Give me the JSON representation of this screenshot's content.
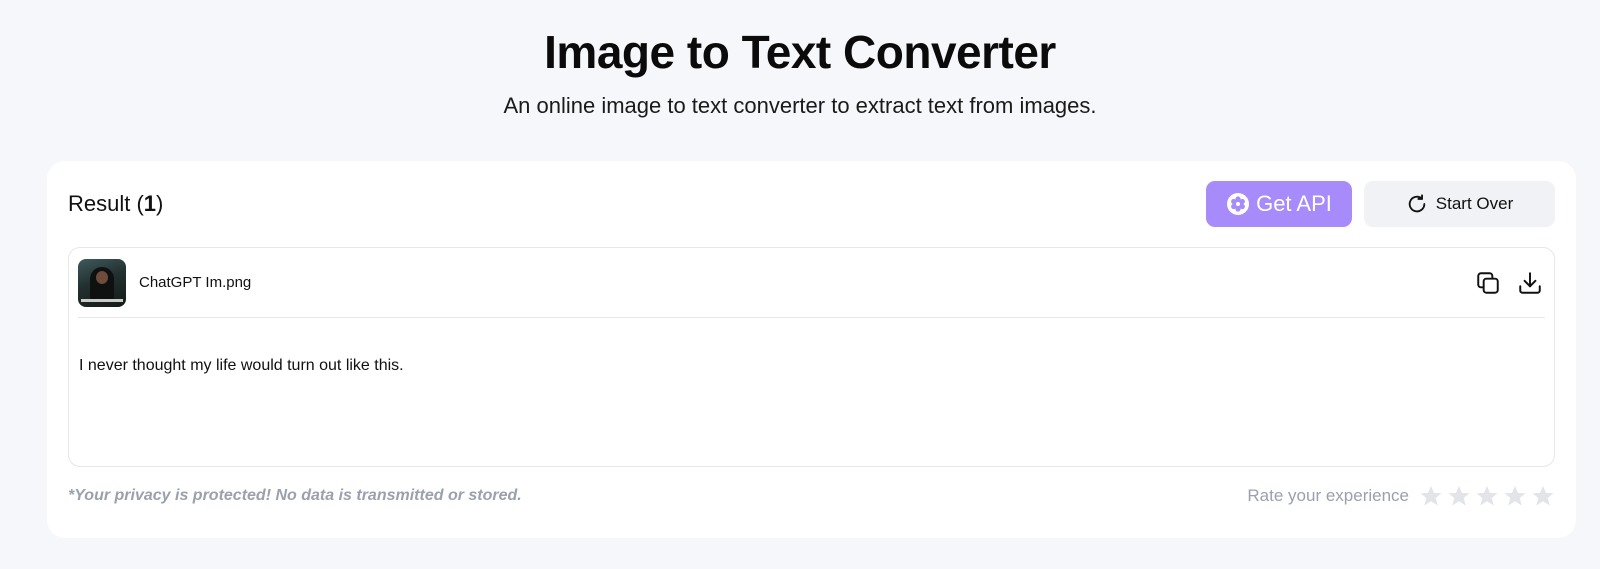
{
  "header": {
    "title": "Image to Text Converter",
    "subtitle": "An online image to text converter to extract text from images."
  },
  "result": {
    "label": "Result (",
    "count": "1",
    "label_close": ")"
  },
  "actions": {
    "get_api_label": "Get API",
    "start_over_label": "Start Over"
  },
  "file": {
    "name": "ChatGPT Im.png",
    "thumbnail_icon": "image-thumbnail",
    "extracted_text": "I never thought my life would turn out like this.",
    "copy_icon": "copy-icon",
    "download_icon": "download-icon"
  },
  "footer": {
    "privacy_note": "*Your privacy is protected! No data is transmitted or stored.",
    "rate_label": "Rate your experience",
    "rating": 0,
    "max_rating": 5
  },
  "colors": {
    "accent": "#a78bfa",
    "page_bg": "#f6f7fa",
    "muted_text": "#9aa1ac",
    "star_empty": "#e3e4e8"
  }
}
